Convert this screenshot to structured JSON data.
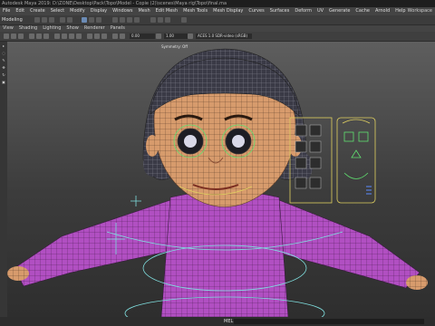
{
  "window": {
    "title": "Autodesk Maya 2019: D:\\ZONE\\Desktop\\Pack\\Topo\\Model - Copie (2)\\scenes\\Maya rig\\Topo\\final.ma"
  },
  "menu": {
    "items": [
      "File",
      "Edit",
      "Create",
      "Select",
      "Modify",
      "Display",
      "Windows",
      "Mesh",
      "Edit Mesh",
      "Mesh Tools",
      "Mesh Display",
      "Curves",
      "Surfaces",
      "Deform",
      "UV",
      "Generate",
      "Cache",
      "Arnold",
      "Help"
    ],
    "workspace": "Workspace"
  },
  "toolbar": {
    "mode": "Modeling",
    "field_a": "0.00",
    "field_b": "1.00",
    "colorspace": "ACES 1.0 SDR-video (sRGB)",
    "snap_field": "Symmetry: Off"
  },
  "panel_menu": {
    "items": [
      "View",
      "Shading",
      "Lighting",
      "Show",
      "Renderer",
      "Panels"
    ]
  },
  "viewport": {
    "label": "persp",
    "hud": "Symmetry: Off"
  },
  "status": {
    "mel_label": "MEL",
    "mel_value": ""
  },
  "colors": {
    "skin": "#d8a070",
    "shirt": "#b04fc0",
    "hair": "#3a3a46",
    "wire_cyan": "#7fdede",
    "rig_yellow": "#e0d060",
    "rig_green": "#60e070"
  }
}
